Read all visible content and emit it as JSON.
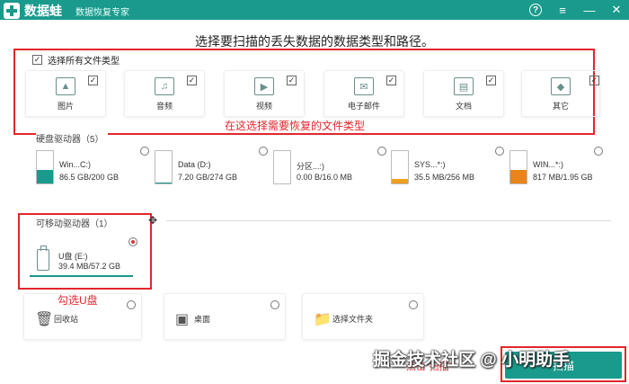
{
  "titlebar": {
    "app_name": "数据蛙",
    "subtitle": "数据恢复专家",
    "icons": [
      "help-icon",
      "menu-icon",
      "minimize-icon",
      "close-icon"
    ]
  },
  "heading": "选择要扫描的丢失数据的数据类型和路径。",
  "file_types": {
    "select_all_label": "选择所有文件类型",
    "items": [
      {
        "label": "图片",
        "icon": "image-icon",
        "checked": true
      },
      {
        "label": "音频",
        "icon": "music-icon",
        "checked": true
      },
      {
        "label": "视频",
        "icon": "video-icon",
        "checked": true
      },
      {
        "label": "电子邮件",
        "icon": "email-icon",
        "checked": true
      },
      {
        "label": "文档",
        "icon": "document-icon",
        "checked": true
      },
      {
        "label": "其它",
        "icon": "other-icon",
        "checked": true
      }
    ],
    "annotation": "在这选择需要恢复的文件类型"
  },
  "hard_drives": {
    "label": "硬盘驱动器（5）",
    "items": [
      {
        "name": "Win...C:)",
        "size": "86.5 GB/200 GB",
        "fill": 0.43,
        "color": "#1a9a8c"
      },
      {
        "name": "Data (D:)",
        "size": "7.20 GB/274 GB",
        "fill": 0.03,
        "color": "#1a9a8c"
      },
      {
        "name": "分区...:)",
        "size": "0.00  B/16.0 MB",
        "fill": 0.0,
        "color": "#1a9a8c"
      },
      {
        "name": "SYS...*:)",
        "size": "35.5 MB/256 MB",
        "fill": 0.14,
        "color": "#f0a020"
      },
      {
        "name": "WIN...*:)",
        "size": "817 MB/1.95 GB",
        "fill": 0.42,
        "color": "#e9831a"
      }
    ]
  },
  "removable": {
    "label": "可移动驱动器（1）",
    "usb_name": "U盘 (E:)",
    "usb_size": "39.4 MB/57.2 GB",
    "selected": true,
    "annotation": "勾选U盘"
  },
  "locations": [
    {
      "label": "回收站",
      "icon": "recycle-bin-icon"
    },
    {
      "label": "桌面",
      "icon": "desktop-icon"
    },
    {
      "label": "选择文件夹",
      "icon": "folder-icon"
    }
  ],
  "scan_button": "扫描",
  "click_hint": "点击“扫描”",
  "watermark": "掘金技术社区 @ 小明助手"
}
